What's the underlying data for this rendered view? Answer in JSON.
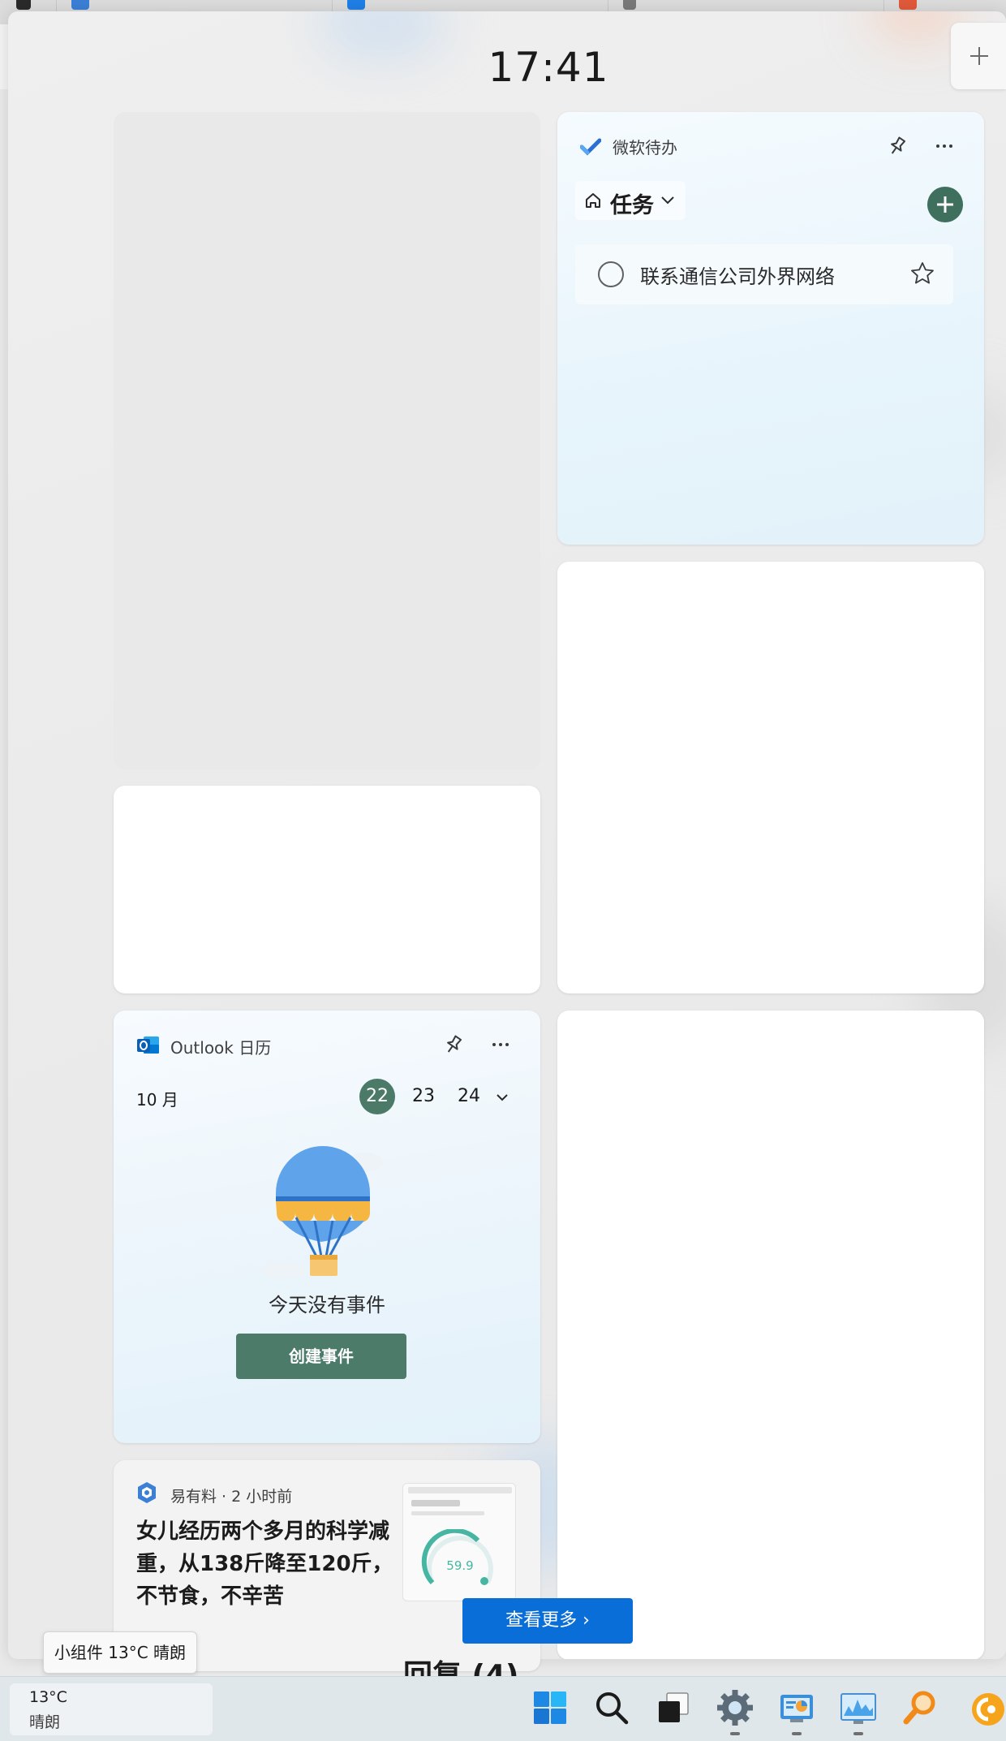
{
  "background": {
    "accent": "#0a6ed8"
  },
  "clock": {
    "time": "17:41"
  },
  "todo": {
    "title": "微软待办",
    "list_name": "任务",
    "tasks": [
      {
        "label": "联系通信公司外界网络",
        "done": false,
        "starred": false
      }
    ]
  },
  "outlook": {
    "title": "Outlook 日历",
    "month": "10 月",
    "days": [
      "22",
      "23",
      "24"
    ],
    "today": "22",
    "empty_message": "今天没有事件",
    "create_button": "创建事件"
  },
  "news": {
    "source": "易有料 · 2 小时前",
    "headline": "女儿经历两个多月的科学减重，从138斤降至120斤，不节食，不辛苦",
    "thumb_value": "59.9"
  },
  "see_more": {
    "label": "查看更多 ›"
  },
  "behind": {
    "text": "回复 (4)"
  },
  "tooltip": {
    "text": "小组件 13°C 晴朗"
  },
  "taskbar": {
    "weather_temp": "13°C",
    "weather_condition": "晴朗",
    "icons": [
      "start-icon",
      "search-icon",
      "task-view-icon",
      "settings-icon",
      "control-panel-icon",
      "resource-monitor-icon",
      "search-tool-icon",
      "browser-icon"
    ]
  },
  "colors": {
    "todo_accent": "#3f6f5d",
    "outlook_accent": "#4d7b69",
    "taskbar": "#dfe7ea"
  }
}
